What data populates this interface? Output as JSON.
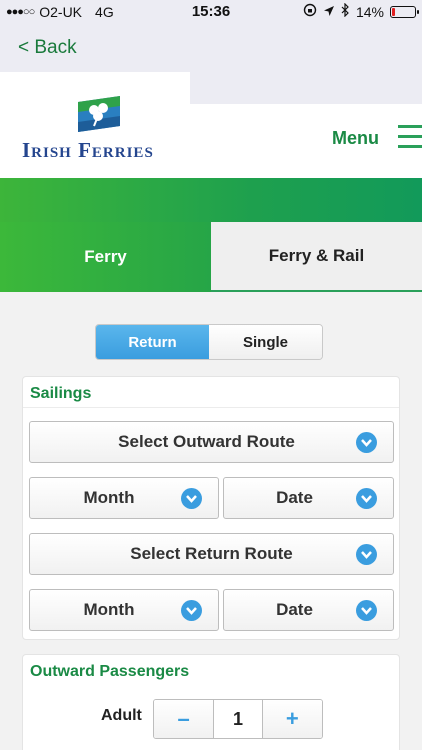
{
  "status_bar": {
    "signal": "●●●○○",
    "carrier": "O2-UK",
    "network": "4G",
    "time": "15:36",
    "battery_percent": "14%",
    "battery_level": 0.14
  },
  "nav": {
    "back_label": "< Back"
  },
  "header": {
    "logo_text": "Irish Ferries",
    "menu_label": "Menu"
  },
  "tabs": [
    {
      "label": "Ferry",
      "active": true
    },
    {
      "label": "Ferry & Rail",
      "active": false
    }
  ],
  "trip_type": {
    "return_label": "Return",
    "single_label": "Single",
    "selected": "Return"
  },
  "sailings": {
    "title": "Sailings",
    "outward_route": "Select Outward Route",
    "outward_month": "Month",
    "outward_date": "Date",
    "return_route": "Select Return Route",
    "return_month": "Month",
    "return_date": "Date"
  },
  "passengers": {
    "title": "Outward Passengers",
    "adult_label": "Adult",
    "adult_count": "1",
    "minus": "–",
    "plus": "+"
  },
  "colors": {
    "brand_green": "#1a8a45",
    "accent_blue": "#3a9ddf",
    "logo_blue": "#24458e"
  }
}
